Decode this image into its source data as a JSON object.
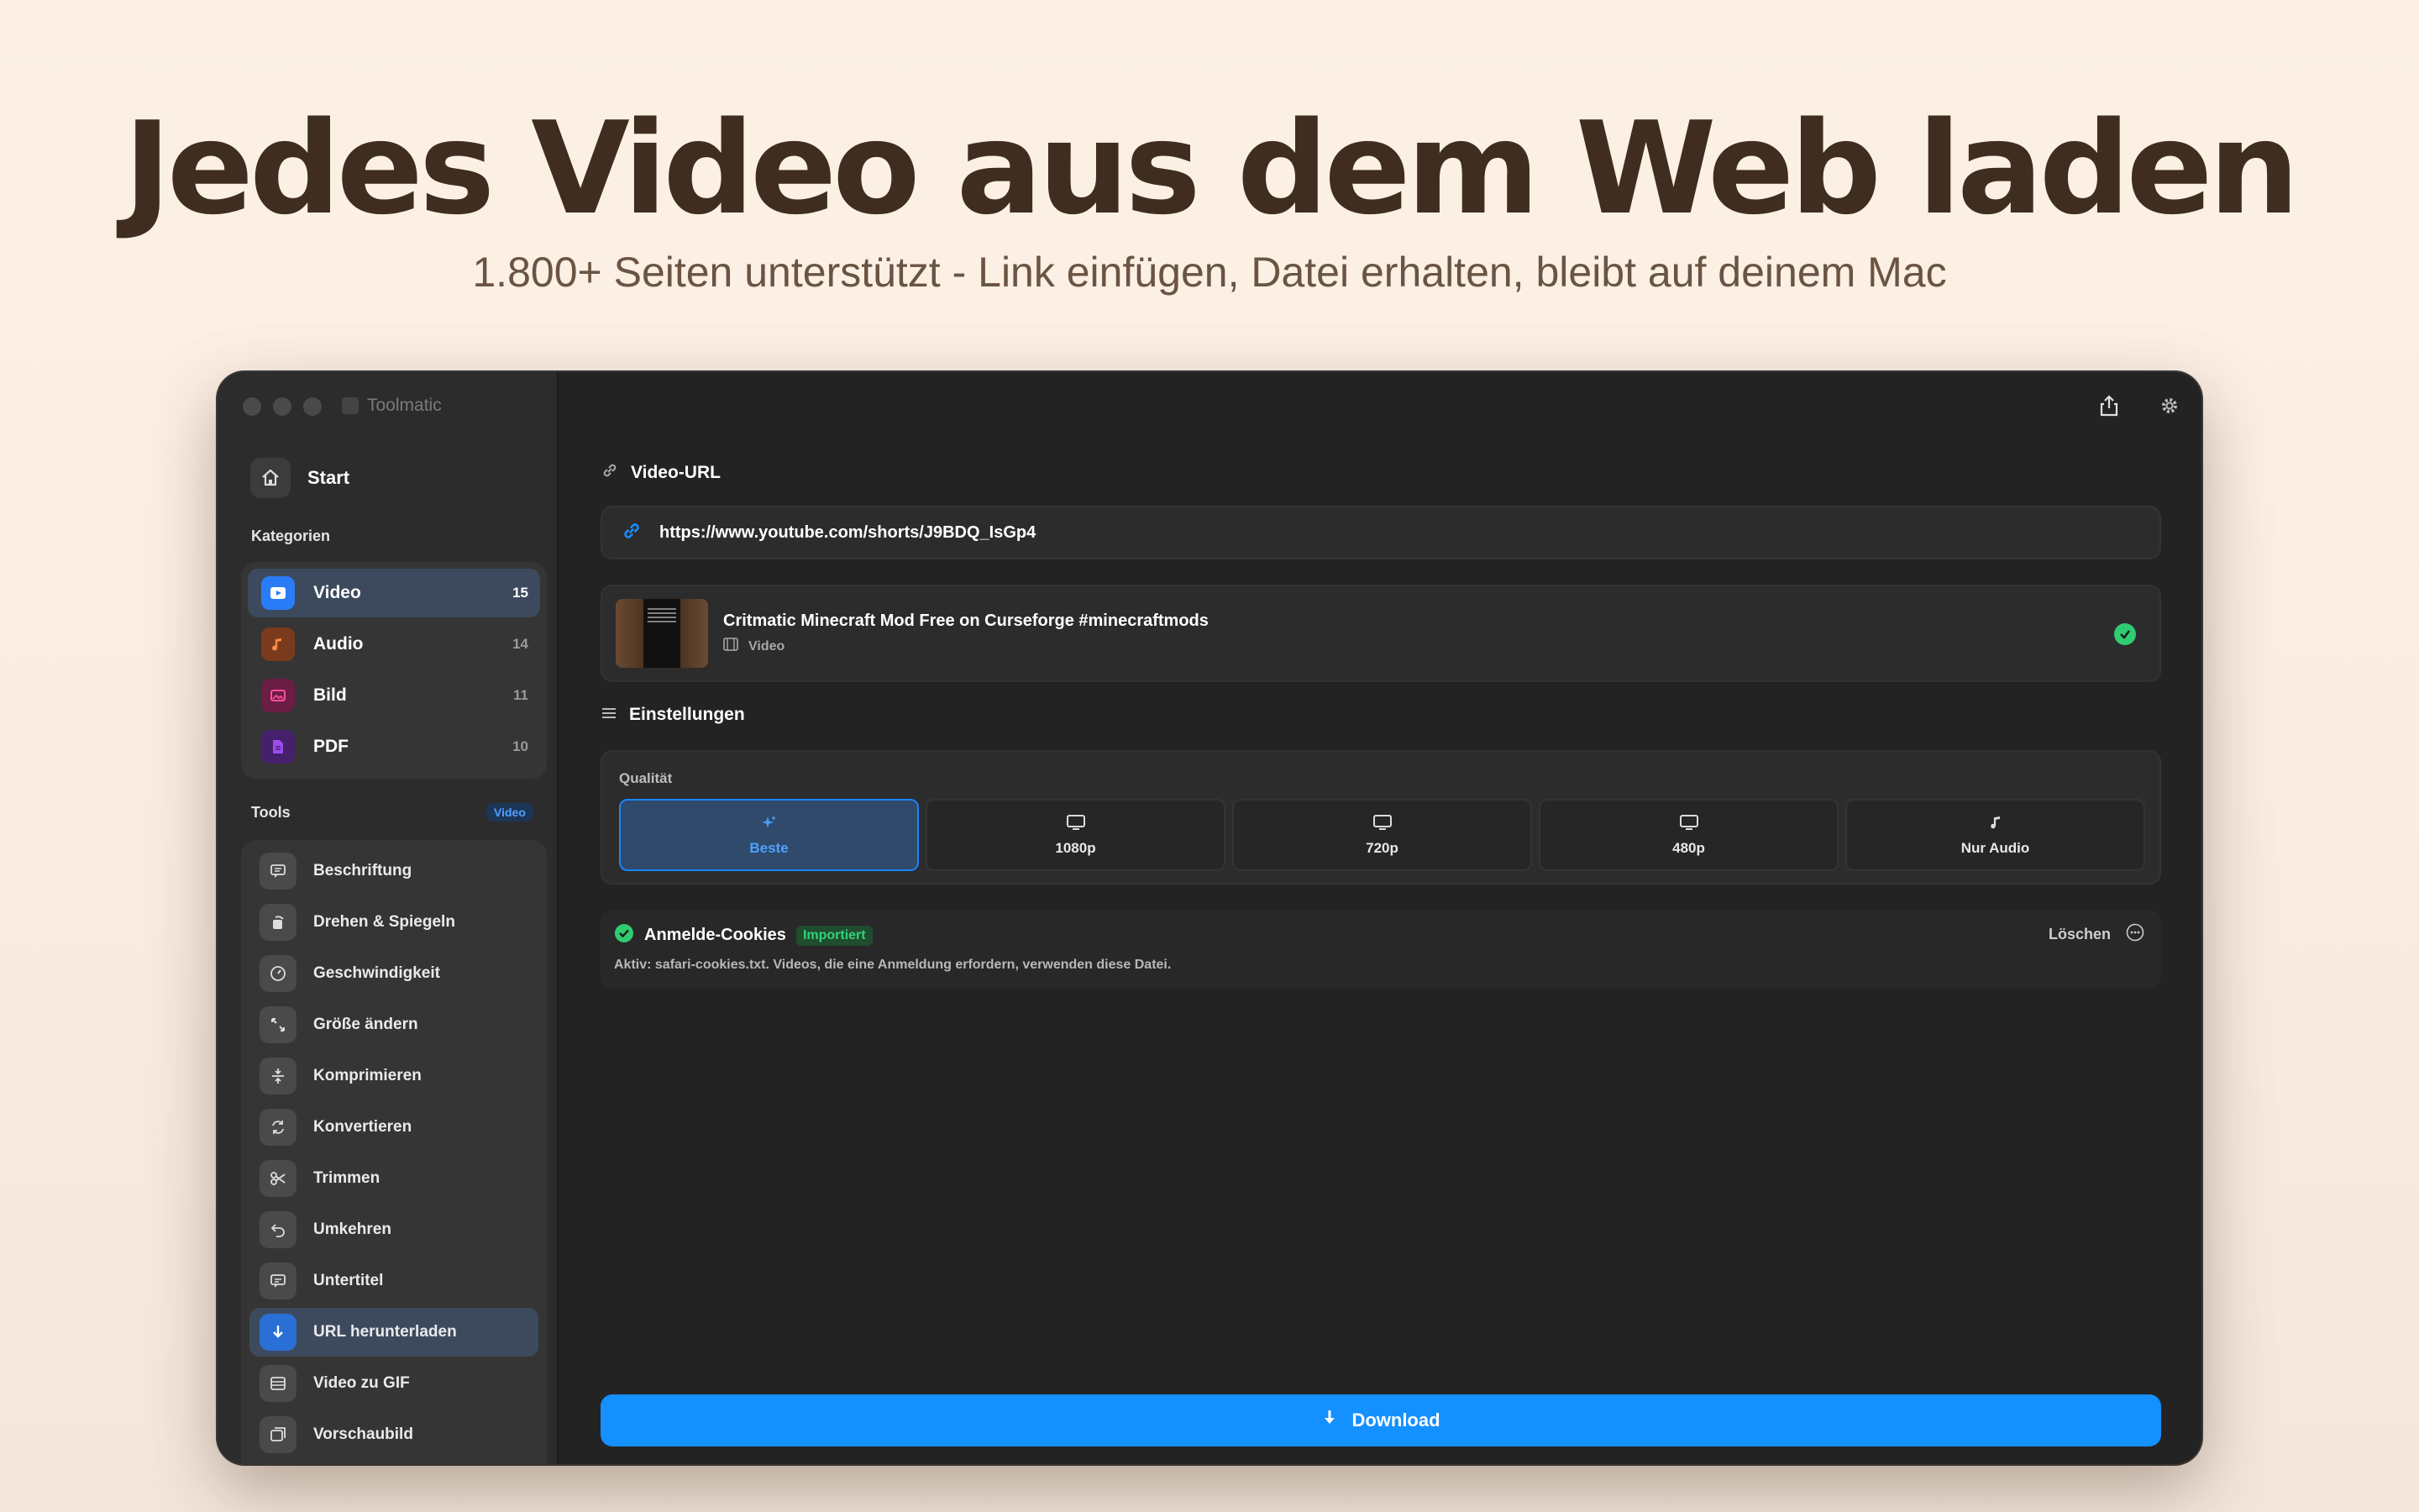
{
  "hero": {
    "title": "Jedes Video aus dem Web laden",
    "subtitle": "1.800+ Seiten unterstützt - Link einfügen, Datei erhalten, bleibt auf deinem Mac"
  },
  "window": {
    "app_name": "Toolmatic"
  },
  "sidebar": {
    "start_label": "Start",
    "categories_label": "Kategorien",
    "categories": [
      {
        "label": "Video",
        "count": "15",
        "icon": "play-icon",
        "color": "#2a7bf6"
      },
      {
        "label": "Audio",
        "count": "14",
        "icon": "music-note-icon",
        "color": "#e0733a"
      },
      {
        "label": "Bild",
        "count": "11",
        "icon": "image-icon",
        "color": "#d6337a"
      },
      {
        "label": "PDF",
        "count": "10",
        "icon": "document-icon",
        "color": "#8a3bd6"
      }
    ],
    "tools_label": "Tools",
    "tools_badge": "Video",
    "tools": [
      {
        "label": "Beschriftung",
        "icon": "caption-icon"
      },
      {
        "label": "Drehen & Spiegeln",
        "icon": "rotate-icon"
      },
      {
        "label": "Geschwindigkeit",
        "icon": "speedometer-icon"
      },
      {
        "label": "Größe ändern",
        "icon": "resize-icon"
      },
      {
        "label": "Komprimieren",
        "icon": "compress-icon"
      },
      {
        "label": "Konvertieren",
        "icon": "convert-icon"
      },
      {
        "label": "Trimmen",
        "icon": "scissors-icon"
      },
      {
        "label": "Umkehren",
        "icon": "reverse-icon"
      },
      {
        "label": "Untertitel",
        "icon": "subtitle-icon"
      },
      {
        "label": "URL herunterladen",
        "icon": "download-arrow-icon"
      },
      {
        "label": "Video zu GIF",
        "icon": "film-icon"
      },
      {
        "label": "Vorschaubild",
        "icon": "thumbnail-icon"
      }
    ]
  },
  "main": {
    "url_label": "Video-URL",
    "url_value": "https://www.youtube.com/shorts/J9BDQ_IsGp4",
    "media": {
      "title": "Critmatic Minecraft Mod Free on Curseforge #minecraftmods",
      "type": "Video"
    },
    "settings_label": "Einstellungen",
    "quality_label": "Qualität",
    "quality_options": [
      {
        "label": "Beste",
        "icon": "sparkle-icon"
      },
      {
        "label": "1080p",
        "icon": "monitor-icon"
      },
      {
        "label": "720p",
        "icon": "monitor-icon"
      },
      {
        "label": "480p",
        "icon": "monitor-icon"
      },
      {
        "label": "Nur Audio",
        "icon": "music-note-icon"
      }
    ],
    "cookies": {
      "title": "Anmelde-Cookies",
      "badge": "Importiert",
      "description": "Aktiv: safari-cookies.txt. Videos, die eine Anmeldung erfordern, verwenden diese Datei.",
      "delete_label": "Löschen"
    },
    "download_label": "Download"
  },
  "colors": {
    "accent": "#1490ff",
    "success": "#2fcc71",
    "window_bg": "#232323"
  }
}
